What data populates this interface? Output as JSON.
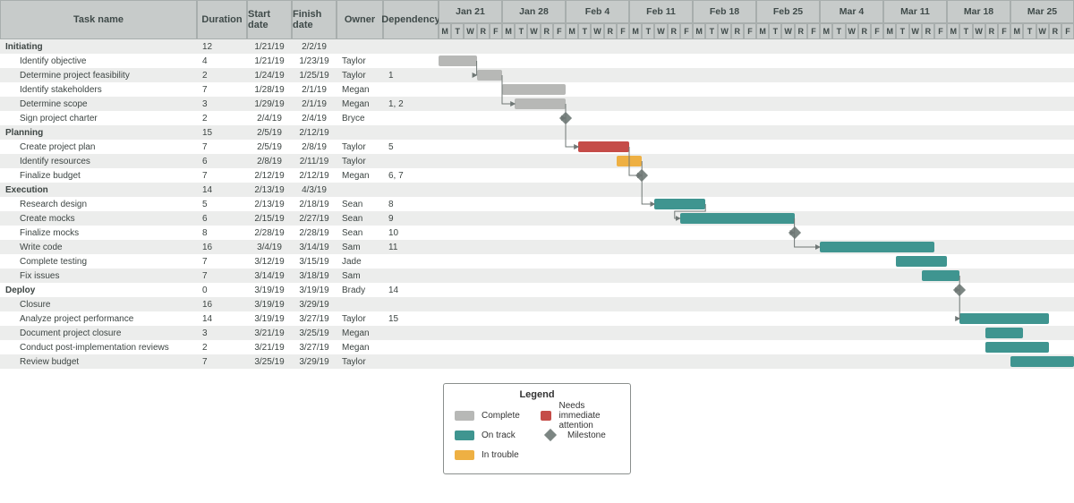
{
  "headers": {
    "task": "Task name",
    "duration": "Duration",
    "start": "Start date",
    "finish": "Finish date",
    "owner": "Owner",
    "dep": "Dependency"
  },
  "weeks": [
    "Jan 21",
    "Jan 28",
    "Feb 4",
    "Feb 11",
    "Feb 18",
    "Feb 25",
    "Mar 4",
    "Mar 11",
    "Mar 18",
    "Mar 25"
  ],
  "days": [
    "M",
    "T",
    "W",
    "R",
    "F"
  ],
  "legend": {
    "title": "Legend",
    "complete": "Complete",
    "ontrack": "On track",
    "trouble": "In trouble",
    "needs": "Needs immediate attention",
    "milestone": "Milestone"
  },
  "rows": [
    {
      "type": "phase",
      "task": "Initiating",
      "dur": "12",
      "sd": "1/21/19",
      "fd": "2/2/19",
      "own": "",
      "dep": ""
    },
    {
      "type": "sub",
      "task": "Identify objective",
      "dur": "4",
      "sd": "1/21/19",
      "fd": "1/23/19",
      "own": "Taylor",
      "dep": "",
      "bar": {
        "status": "complete",
        "start": 0,
        "len": 3
      }
    },
    {
      "type": "sub",
      "task": "Determine project feasibility",
      "dur": "2",
      "sd": "1/24/19",
      "fd": "1/25/19",
      "own": "Taylor",
      "dep": "1",
      "bar": {
        "status": "complete",
        "start": 3,
        "len": 2
      }
    },
    {
      "type": "sub",
      "task": "Identify stakeholders",
      "dur": "7",
      "sd": "1/28/19",
      "fd": "2/1/19",
      "own": "Megan",
      "dep": "",
      "bar": {
        "status": "complete",
        "start": 5,
        "len": 5
      }
    },
    {
      "type": "sub",
      "task": "Determine scope",
      "dur": "3",
      "sd": "1/29/19",
      "fd": "2/1/19",
      "own": "Megan",
      "dep": "1, 2",
      "bar": {
        "status": "complete",
        "start": 6,
        "len": 4
      }
    },
    {
      "type": "sub",
      "task": "Sign project charter",
      "dur": "2",
      "sd": "2/4/19",
      "fd": "2/4/19",
      "own": "Bryce",
      "dep": "",
      "ms": 10
    },
    {
      "type": "phase",
      "task": "Planning",
      "dur": "15",
      "sd": "2/5/19",
      "fd": "2/12/19",
      "own": "",
      "dep": ""
    },
    {
      "type": "sub",
      "task": "Create project plan",
      "dur": "7",
      "sd": "2/5/19",
      "fd": "2/8/19",
      "own": "Taylor",
      "dep": "5",
      "bar": {
        "status": "needs",
        "start": 11,
        "len": 4
      }
    },
    {
      "type": "sub",
      "task": "Identify resources",
      "dur": "6",
      "sd": "2/8/19",
      "fd": "2/11/19",
      "own": "Taylor",
      "dep": "",
      "bar": {
        "status": "trouble",
        "start": 14,
        "len": 2
      }
    },
    {
      "type": "sub",
      "task": "Finalize budget",
      "dur": "7",
      "sd": "2/12/19",
      "fd": "2/12/19",
      "own": "Megan",
      "dep": "6, 7",
      "ms": 16
    },
    {
      "type": "phase",
      "task": "Execution",
      "dur": "14",
      "sd": "2/13/19",
      "fd": "4/3/19",
      "own": "",
      "dep": ""
    },
    {
      "type": "sub",
      "task": "Research design",
      "dur": "5",
      "sd": "2/13/19",
      "fd": "2/18/19",
      "own": "Sean",
      "dep": "8",
      "bar": {
        "status": "ontrack",
        "start": 17,
        "len": 4
      }
    },
    {
      "type": "sub",
      "task": "Create mocks",
      "dur": "6",
      "sd": "2/15/19",
      "fd": "2/27/19",
      "own": "Sean",
      "dep": "9",
      "bar": {
        "status": "ontrack",
        "start": 19,
        "len": 9
      }
    },
    {
      "type": "sub",
      "task": "Finalize mocks",
      "dur": "8",
      "sd": "2/28/19",
      "fd": "2/28/19",
      "own": "Sean",
      "dep": "10",
      "ms": 28
    },
    {
      "type": "sub",
      "task": "Write code",
      "dur": "16",
      "sd": "3/4/19",
      "fd": "3/14/19",
      "own": "Sam",
      "dep": "11",
      "bar": {
        "status": "ontrack",
        "start": 30,
        "len": 9
      }
    },
    {
      "type": "sub",
      "task": "Complete testing",
      "dur": "7",
      "sd": "3/12/19",
      "fd": "3/15/19",
      "own": "Jade",
      "dep": "",
      "bar": {
        "status": "ontrack",
        "start": 36,
        "len": 4
      }
    },
    {
      "type": "sub",
      "task": "Fix issues",
      "dur": "7",
      "sd": "3/14/19",
      "fd": "3/18/19",
      "own": "Sam",
      "dep": "",
      "bar": {
        "status": "ontrack",
        "start": 38,
        "len": 3
      }
    },
    {
      "type": "phase",
      "task": "Deploy",
      "dur": "0",
      "sd": "3/19/19",
      "fd": "3/19/19",
      "own": "Brady",
      "dep": "14",
      "ms": 41
    },
    {
      "type": "sub",
      "task": "Closure",
      "dur": "16",
      "sd": "3/19/19",
      "fd": "3/29/19",
      "own": "",
      "dep": ""
    },
    {
      "type": "sub",
      "task": "Analyze project performance",
      "dur": "14",
      "sd": "3/19/19",
      "fd": "3/27/19",
      "own": "Taylor",
      "dep": "15",
      "bar": {
        "status": "ontrack",
        "start": 41,
        "len": 7
      }
    },
    {
      "type": "sub",
      "task": "Document project closure",
      "dur": "3",
      "sd": "3/21/19",
      "fd": "3/25/19",
      "own": "Megan",
      "dep": "",
      "bar": {
        "status": "ontrack",
        "start": 43,
        "len": 3
      }
    },
    {
      "type": "sub",
      "task": "Conduct post-implementation reviews",
      "dur": "2",
      "sd": "3/21/19",
      "fd": "3/27/19",
      "own": "Megan",
      "dep": "",
      "bar": {
        "status": "ontrack",
        "start": 43,
        "len": 5
      }
    },
    {
      "type": "sub",
      "task": "Review budget",
      "dur": "7",
      "sd": "3/25/19",
      "fd": "3/29/19",
      "own": "Taylor",
      "dep": "",
      "bar": {
        "status": "ontrack",
        "start": 45,
        "len": 5
      }
    }
  ],
  "dependencies": [
    {
      "fromRow": 1,
      "fromDay": 3,
      "toRow": 2,
      "toDay": 3
    },
    {
      "fromRow": 2,
      "fromDay": 5,
      "toRow": 4,
      "toDay": 6
    },
    {
      "fromRow": 4,
      "fromDay": 10,
      "toRow": 5,
      "toDay": 10,
      "toMs": true
    },
    {
      "fromRow": 5,
      "fromDay": 10,
      "toRow": 7,
      "toDay": 11,
      "fromMs": true
    },
    {
      "fromRow": 7,
      "fromDay": 15,
      "toRow": 9,
      "toDay": 16,
      "toMs": true
    },
    {
      "fromRow": 8,
      "fromDay": 16,
      "toRow": 9,
      "toDay": 16,
      "toMs": true
    },
    {
      "fromRow": 9,
      "fromDay": 16,
      "toRow": 11,
      "toDay": 17,
      "fromMs": true
    },
    {
      "fromRow": 11,
      "fromDay": 21,
      "toRow": 12,
      "toDay": 19,
      "back": true
    },
    {
      "fromRow": 12,
      "fromDay": 28,
      "toRow": 13,
      "toDay": 28,
      "toMs": true
    },
    {
      "fromRow": 13,
      "fromDay": 28,
      "toRow": 14,
      "toDay": 30,
      "fromMs": true
    },
    {
      "fromRow": 16,
      "fromDay": 41,
      "toRow": 17,
      "toDay": 41,
      "toMs": true
    },
    {
      "fromRow": 17,
      "fromDay": 41,
      "toRow": 19,
      "toDay": 41,
      "fromMs": true
    }
  ],
  "chart_data": {
    "type": "gantt",
    "title": "Project Gantt Chart",
    "x_start": "2019-01-21",
    "x_end": "2019-03-29",
    "x_unit": "weekday",
    "status_colors": {
      "complete": "#b7b8b6",
      "ontrack": "#3f9590",
      "trouble": "#eeb043",
      "needs": "#c54c48",
      "milestone": "#7c8683"
    },
    "tasks": [
      {
        "id": 1,
        "group": "Initiating",
        "name": "Identify objective",
        "start": "2019-01-21",
        "end": "2019-01-23",
        "owner": "Taylor",
        "duration": 4,
        "status": "complete"
      },
      {
        "id": 2,
        "group": "Initiating",
        "name": "Determine project feasibility",
        "start": "2019-01-24",
        "end": "2019-01-25",
        "owner": "Taylor",
        "duration": 2,
        "dep": [
          1
        ],
        "status": "complete"
      },
      {
        "id": 3,
        "group": "Initiating",
        "name": "Identify stakeholders",
        "start": "2019-01-28",
        "end": "2019-02-01",
        "owner": "Megan",
        "duration": 7,
        "status": "complete"
      },
      {
        "id": 4,
        "group": "Initiating",
        "name": "Determine scope",
        "start": "2019-01-29",
        "end": "2019-02-01",
        "owner": "Megan",
        "duration": 3,
        "dep": [
          1,
          2
        ],
        "status": "complete"
      },
      {
        "id": 5,
        "group": "Initiating",
        "name": "Sign project charter",
        "start": "2019-02-04",
        "end": "2019-02-04",
        "owner": "Bryce",
        "duration": 2,
        "status": "milestone"
      },
      {
        "id": 6,
        "group": "Planning",
        "name": "Create project plan",
        "start": "2019-02-05",
        "end": "2019-02-08",
        "owner": "Taylor",
        "duration": 7,
        "dep": [
          5
        ],
        "status": "needs"
      },
      {
        "id": 7,
        "group": "Planning",
        "name": "Identify resources",
        "start": "2019-02-08",
        "end": "2019-02-11",
        "owner": "Taylor",
        "duration": 6,
        "status": "trouble"
      },
      {
        "id": 8,
        "group": "Planning",
        "name": "Finalize budget",
        "start": "2019-02-12",
        "end": "2019-02-12",
        "owner": "Megan",
        "duration": 7,
        "dep": [
          6,
          7
        ],
        "status": "milestone"
      },
      {
        "id": 9,
        "group": "Execution",
        "name": "Research design",
        "start": "2019-02-13",
        "end": "2019-02-18",
        "owner": "Sean",
        "duration": 5,
        "dep": [
          8
        ],
        "status": "ontrack"
      },
      {
        "id": 10,
        "group": "Execution",
        "name": "Create mocks",
        "start": "2019-02-15",
        "end": "2019-02-27",
        "owner": "Sean",
        "duration": 6,
        "dep": [
          9
        ],
        "status": "ontrack"
      },
      {
        "id": 11,
        "group": "Execution",
        "name": "Finalize mocks",
        "start": "2019-02-28",
        "end": "2019-02-28",
        "owner": "Sean",
        "duration": 8,
        "dep": [
          10
        ],
        "status": "milestone"
      },
      {
        "id": 12,
        "group": "Execution",
        "name": "Write code",
        "start": "2019-03-04",
        "end": "2019-03-14",
        "owner": "Sam",
        "duration": 16,
        "dep": [
          11
        ],
        "status": "ontrack"
      },
      {
        "id": 13,
        "group": "Execution",
        "name": "Complete testing",
        "start": "2019-03-12",
        "end": "2019-03-15",
        "owner": "Jade",
        "duration": 7,
        "status": "ontrack"
      },
      {
        "id": 14,
        "group": "Execution",
        "name": "Fix issues",
        "start": "2019-03-14",
        "end": "2019-03-18",
        "owner": "Sam",
        "duration": 7,
        "status": "ontrack"
      },
      {
        "id": 15,
        "group": "Deploy",
        "name": "Deploy",
        "start": "2019-03-19",
        "end": "2019-03-19",
        "owner": "Brady",
        "duration": 0,
        "dep": [
          14
        ],
        "status": "milestone"
      },
      {
        "id": 16,
        "group": "Deploy",
        "name": "Closure",
        "start": "2019-03-19",
        "end": "2019-03-29",
        "duration": 16
      },
      {
        "id": 17,
        "group": "Deploy",
        "name": "Analyze project performance",
        "start": "2019-03-19",
        "end": "2019-03-27",
        "owner": "Taylor",
        "duration": 14,
        "dep": [
          15
        ],
        "status": "ontrack"
      },
      {
        "id": 18,
        "group": "Deploy",
        "name": "Document project closure",
        "start": "2019-03-21",
        "end": "2019-03-25",
        "owner": "Megan",
        "duration": 3,
        "status": "ontrack"
      },
      {
        "id": 19,
        "group": "Deploy",
        "name": "Conduct post-implementation reviews",
        "start": "2019-03-21",
        "end": "2019-03-27",
        "owner": "Megan",
        "duration": 2,
        "status": "ontrack"
      },
      {
        "id": 20,
        "group": "Deploy",
        "name": "Review budget",
        "start": "2019-03-25",
        "end": "2019-03-29",
        "owner": "Taylor",
        "duration": 7,
        "status": "ontrack"
      }
    ]
  }
}
